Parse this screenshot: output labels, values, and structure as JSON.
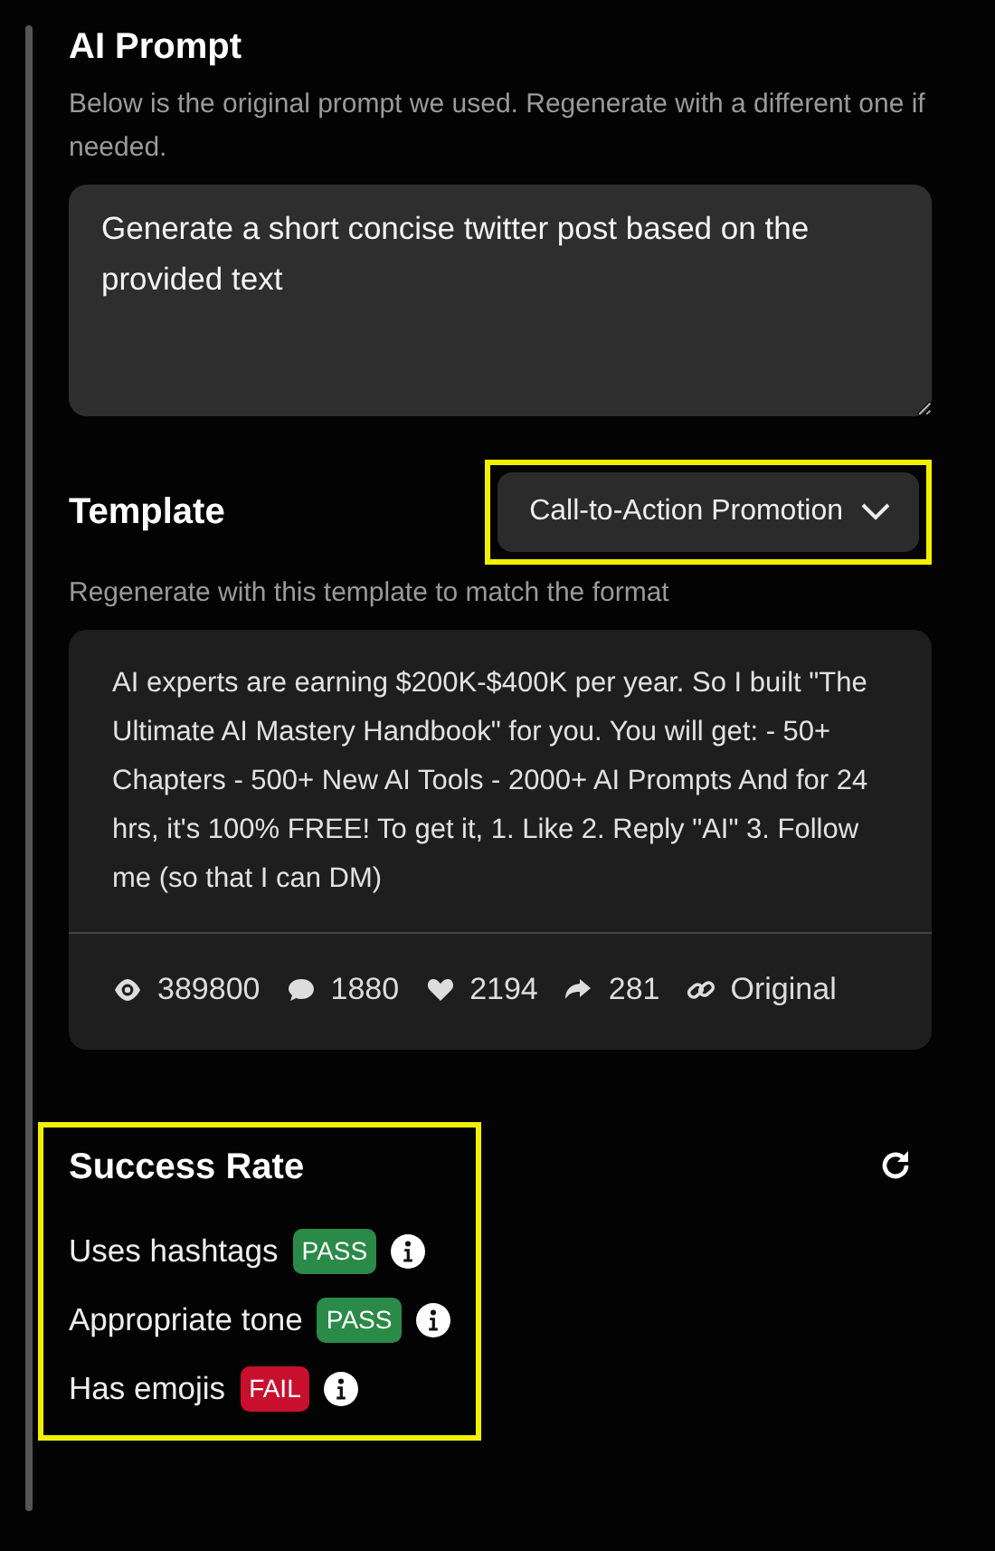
{
  "prompt": {
    "title": "AI Prompt",
    "description": "Below is the original prompt we used. Regenerate with a different one if needed.",
    "value": "Generate a short concise twitter post based on the provided text"
  },
  "template": {
    "title": "Template",
    "dropdown": {
      "label": "Call-to-Action Promotion",
      "highlighted": true
    },
    "description": "Regenerate with this template to match the format",
    "post": {
      "text": "AI experts are earning $200K-$400K per year. So I built \"The Ultimate AI Mastery Handbook\" for you. You will get: - 50+ Chapters - 500+ New AI Tools - 2000+ AI Prompts And for 24 hrs, it's 100% FREE! To get it, 1. Like 2. Reply \"AI\" 3. Follow me (so that I can DM)",
      "stats": [
        {
          "kind": "views",
          "value": "389800"
        },
        {
          "kind": "comments",
          "value": "1880"
        },
        {
          "kind": "likes",
          "value": "2194"
        },
        {
          "kind": "shares",
          "value": "281"
        },
        {
          "kind": "link",
          "value": "Original"
        }
      ]
    }
  },
  "success_rate": {
    "title": "Success Rate",
    "highlighted": true,
    "checks": [
      {
        "label": "Uses hashtags",
        "result": "PASS",
        "passed": true
      },
      {
        "label": "Appropriate tone",
        "result": "PASS",
        "passed": true
      },
      {
        "label": "Has emojis",
        "result": "FAIL",
        "passed": false
      }
    ]
  }
}
